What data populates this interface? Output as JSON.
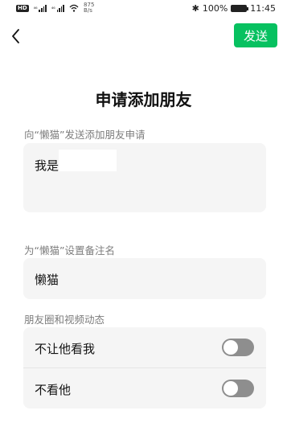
{
  "status_bar": {
    "hd_badge": "HD",
    "signal_1": "⁴⁶",
    "signal_2": "⁴⁶",
    "net_speed_value": "875",
    "net_speed_unit": "B/s",
    "bluetooth_symbol": "✱",
    "battery_percent": "100%",
    "battery_level": 1.0,
    "time": "11:45"
  },
  "header": {
    "send_label": "发送"
  },
  "page_title": "申请添加朋友",
  "request": {
    "label": "向“懒猫”发送添加朋友申请",
    "message": "我是"
  },
  "remark": {
    "label": "为“懒猫”设置备注名",
    "value": "懒猫"
  },
  "moments": {
    "label": "朋友圈和视频动态",
    "items": [
      {
        "label": "不让他看我",
        "enabled": false
      },
      {
        "label": "不看他",
        "enabled": false
      }
    ]
  },
  "colors": {
    "accent": "#07c160",
    "card_bg": "#f5f5f5",
    "toggle_off": "#8e8e8e"
  }
}
